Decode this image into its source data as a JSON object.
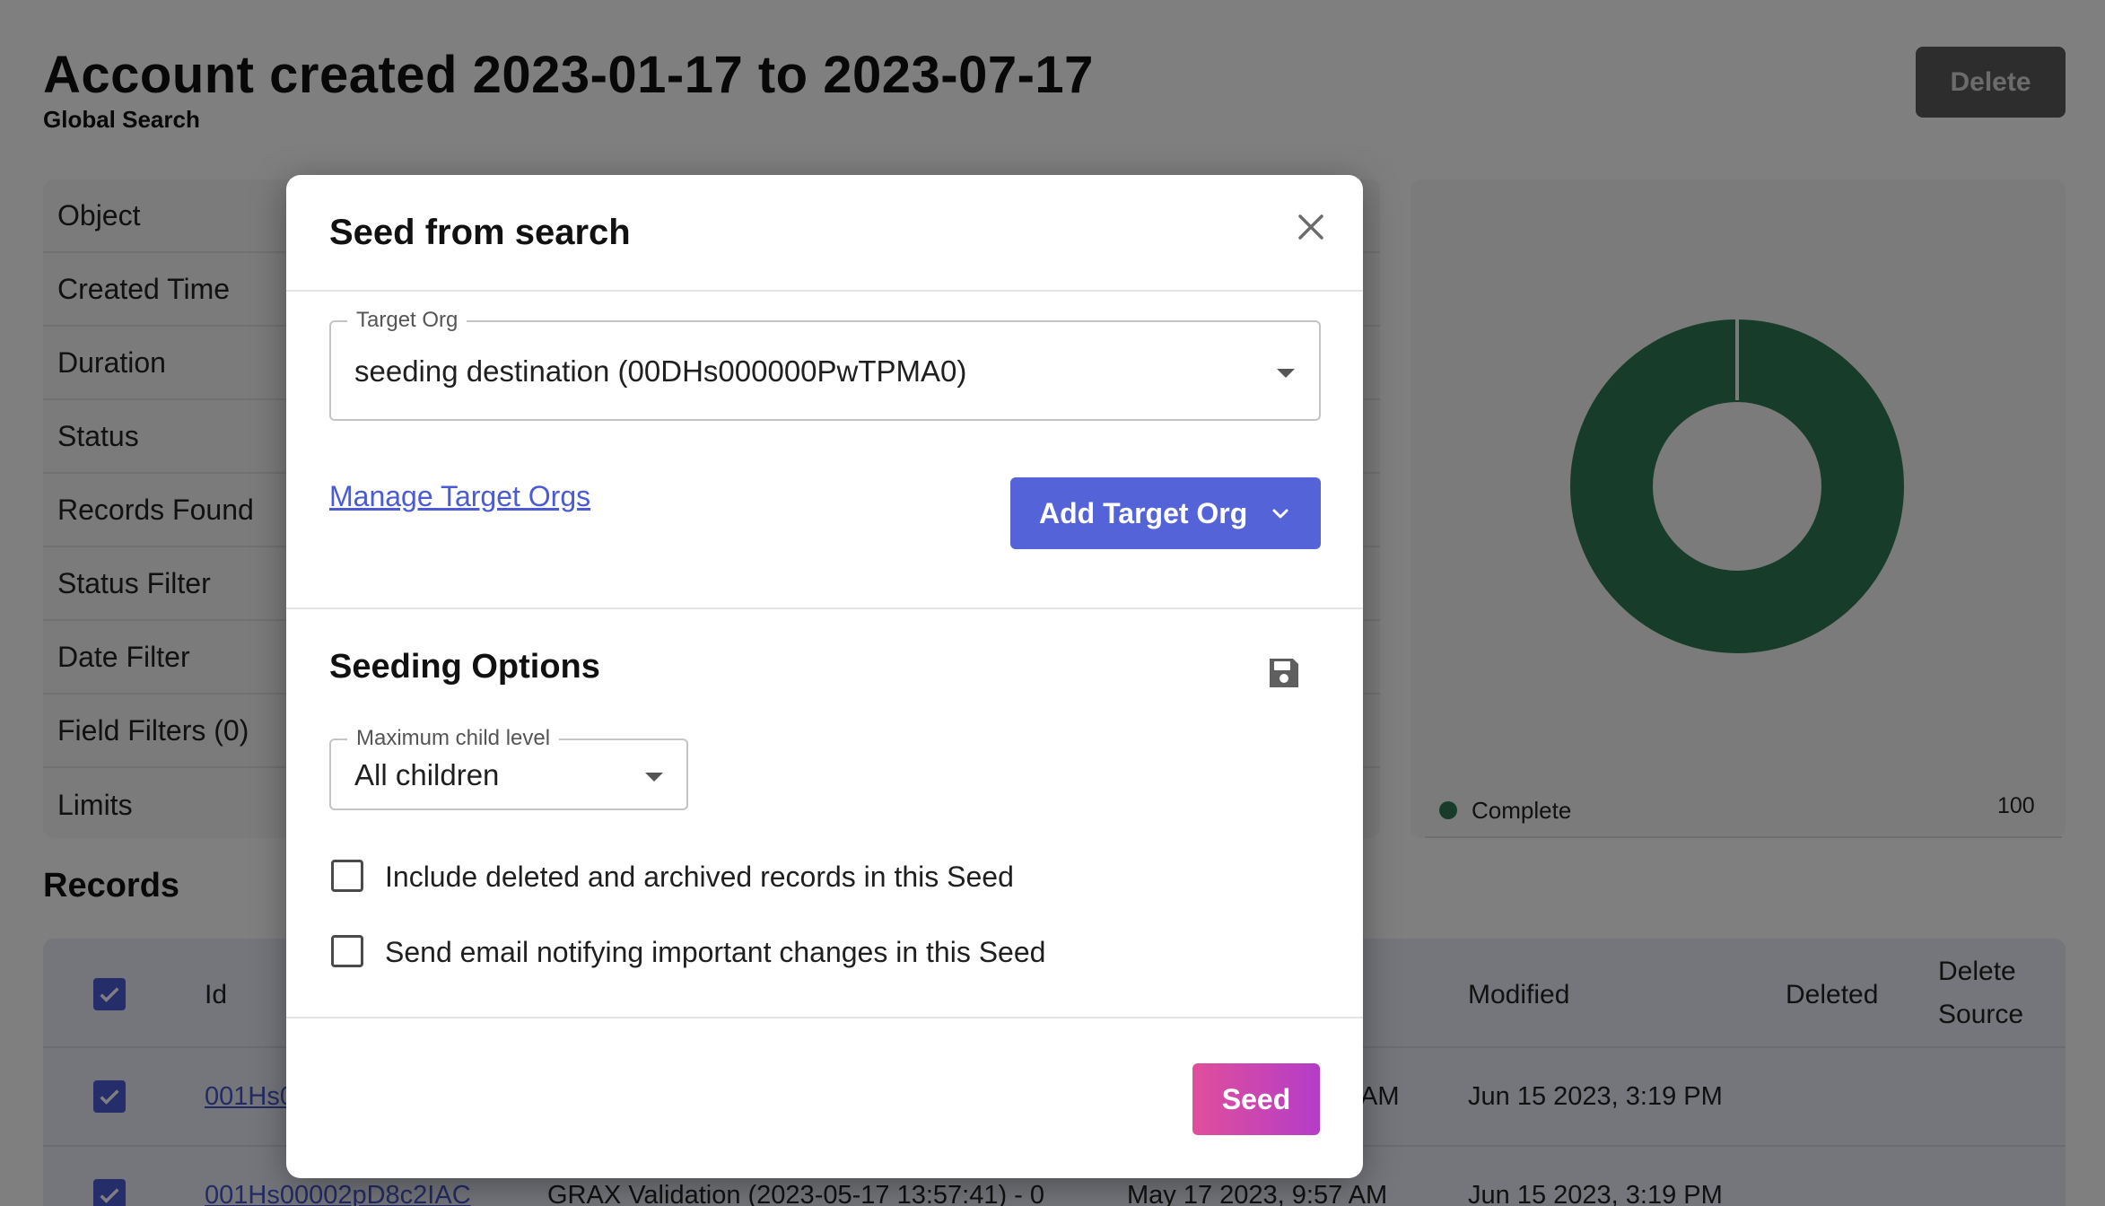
{
  "page": {
    "title": "Account created 2023-01-17 to 2023-07-17",
    "subtitle": "Global Search",
    "delete_label": "Delete"
  },
  "details": {
    "rows": [
      "Object",
      "Created Time",
      "Duration",
      "Status",
      "Records Found",
      "Status Filter",
      "Date Filter",
      "Field Filters (0)",
      "Limits"
    ]
  },
  "status_chart": {
    "legend_label": "Complete",
    "legend_value": "100",
    "color": "#2f7a55"
  },
  "records": {
    "heading": "Records",
    "columns": {
      "id": "Id",
      "modified": "Modified",
      "deleted": "Deleted",
      "delete_source_1": "Delete",
      "delete_source_2": "Source"
    },
    "rows": [
      {
        "id": "001Hs0",
        "created_tail": "AM",
        "modified": "Jun 15 2023, 3:19 PM"
      },
      {
        "id": "001Hs00002pD8c2IAC",
        "name": "GRAX Validation (2023-05-17 13:57:41) - 0",
        "created": "May 17 2023, 9:57 AM",
        "modified": "Jun 15 2023, 3:19 PM"
      }
    ]
  },
  "modal": {
    "title": "Seed from search",
    "target_org": {
      "label": "Target Org",
      "value": "seeding destination (00DHs000000PwTPMA0)"
    },
    "manage_link": "Manage Target Orgs",
    "add_org_button": "Add Target Org",
    "seeding_options": {
      "title": "Seeding Options",
      "max_child": {
        "label": "Maximum child level",
        "value": "All children"
      },
      "include_deleted": {
        "label": "Include deleted and archived records in this Seed",
        "checked": false
      },
      "send_email": {
        "label": "Send email notifying important changes in this Seed",
        "checked": false
      }
    },
    "seed_button": "Seed"
  },
  "colors": {
    "accent": "#5464d8",
    "seed_gradient_start": "#e04f9b",
    "seed_gradient_end": "#b43cc8",
    "link": "#4a5bd4"
  }
}
